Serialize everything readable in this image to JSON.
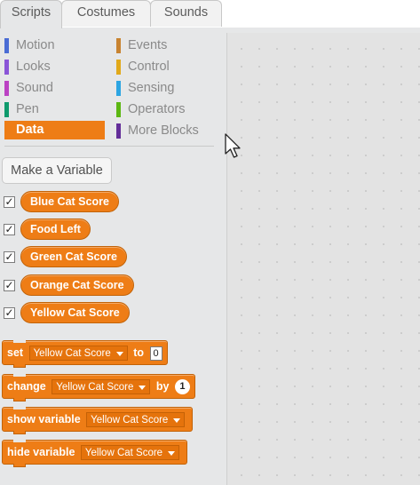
{
  "tabs": [
    {
      "label": "Scripts",
      "active": true
    },
    {
      "label": "Costumes",
      "active": false
    },
    {
      "label": "Sounds",
      "active": false
    }
  ],
  "categories": {
    "left": [
      {
        "label": "Motion",
        "color": "#4a6cd4"
      },
      {
        "label": "Looks",
        "color": "#8a55d7"
      },
      {
        "label": "Sound",
        "color": "#bb42c3"
      },
      {
        "label": "Pen",
        "color": "#0e9a6c"
      },
      {
        "label": "Data",
        "color": "#ee7d16",
        "selected": true
      }
    ],
    "right": [
      {
        "label": "Events",
        "color": "#c88330"
      },
      {
        "label": "Control",
        "color": "#e1a91a"
      },
      {
        "label": "Sensing",
        "color": "#2ca5e2"
      },
      {
        "label": "Operators",
        "color": "#5cb712"
      },
      {
        "label": "More Blocks",
        "color": "#632d99"
      }
    ]
  },
  "make_variable_label": "Make a Variable",
  "variables": [
    {
      "name": "Blue Cat Score",
      "checked": true
    },
    {
      "name": "Food Left",
      "checked": true
    },
    {
      "name": "Green Cat Score",
      "checked": true
    },
    {
      "name": "Orange Cat Score",
      "checked": true
    },
    {
      "name": "Yellow Cat Score",
      "checked": true
    }
  ],
  "blocks": {
    "set": {
      "keyword": "set",
      "variable": "Yellow Cat Score",
      "joiner": "to",
      "value": "0"
    },
    "change": {
      "keyword": "change",
      "variable": "Yellow Cat Score",
      "joiner": "by",
      "value": "1"
    },
    "show": {
      "keyword": "show variable",
      "variable": "Yellow Cat Score"
    },
    "hide": {
      "keyword": "hide variable",
      "variable": "Yellow Cat Score"
    }
  },
  "check_glyph": "✓",
  "colors": {
    "data_orange": "#ee7d16",
    "palette_bg": "#e6e7e8",
    "script_bg": "#e3e3e3"
  }
}
